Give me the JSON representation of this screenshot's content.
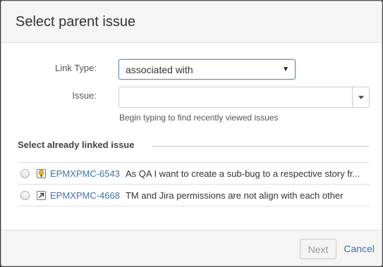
{
  "dialog": {
    "title": "Select parent issue"
  },
  "form": {
    "link_type_label": "Link Type:",
    "link_type_value": "associated with",
    "issue_label": "Issue:",
    "issue_value": "",
    "issue_hint": "Begin typing to find recently viewed issues"
  },
  "linked_section": {
    "heading": "Select already linked issue",
    "items": [
      {
        "key": "EPMXPMC-6543",
        "summary": "As QA I want to create a sub-bug to a respective story fr...",
        "icon": "lightbulb-icon",
        "icon_color": "#f0b21a"
      },
      {
        "key": "EPMXPMC-4668",
        "summary": "TM and Jira permissions are not align with each other",
        "icon": "arrow-up-right-icon",
        "icon_color": "#333333"
      }
    ]
  },
  "footer": {
    "next_label": "Next",
    "cancel_label": "Cancel"
  },
  "colors": {
    "link": "#3b73af",
    "header_bg": "#f5f5f5"
  }
}
